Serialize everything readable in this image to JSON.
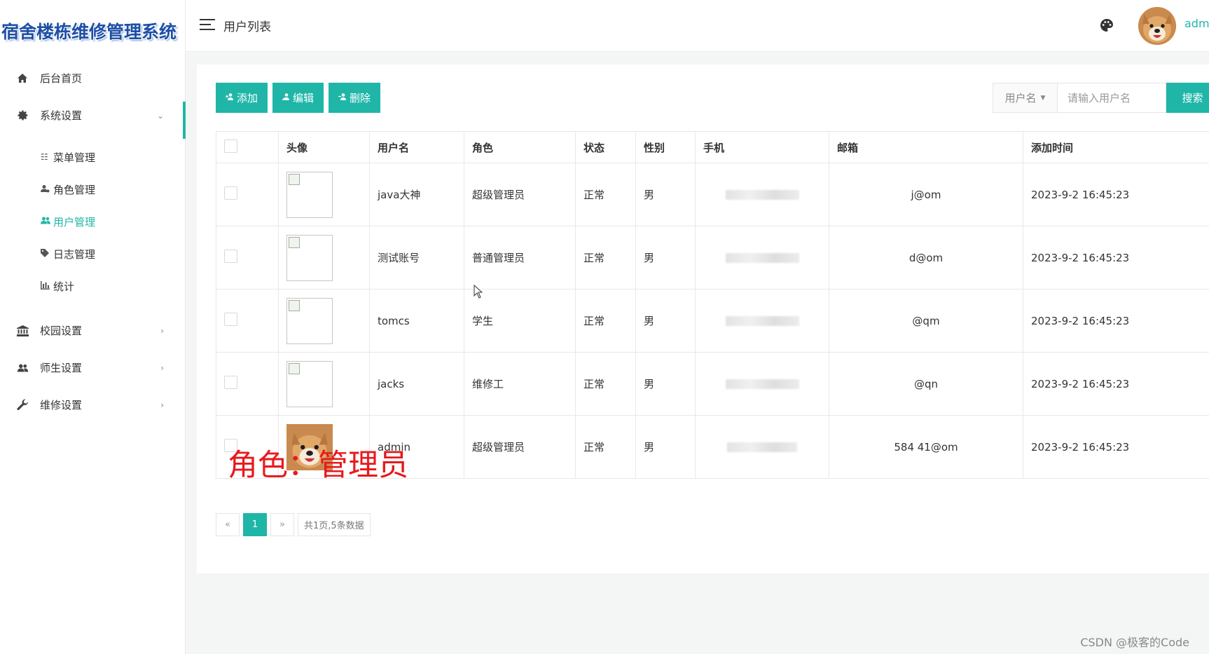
{
  "app": {
    "title": "宿舍楼栋维修管理系统"
  },
  "header": {
    "page_title": "用户列表",
    "user_name": "adm"
  },
  "sidebar": {
    "items": [
      {
        "label": "后台首页",
        "icon": "home-icon"
      },
      {
        "label": "系统设置",
        "icon": "gear-icon",
        "expanded": true,
        "children": [
          {
            "label": "菜单管理",
            "icon": "list-icon"
          },
          {
            "label": "角色管理",
            "icon": "user-gear-icon"
          },
          {
            "label": "用户管理",
            "icon": "users-icon",
            "active": true
          },
          {
            "label": "日志管理",
            "icon": "tag-icon"
          },
          {
            "label": "统计",
            "icon": "bar-chart-icon"
          }
        ]
      },
      {
        "label": "校园设置",
        "icon": "bank-icon"
      },
      {
        "label": "师生设置",
        "icon": "users-icon"
      },
      {
        "label": "维修设置",
        "icon": "wrench-icon"
      }
    ]
  },
  "toolbar": {
    "add_label": "添加",
    "edit_label": "编辑",
    "delete_label": "删除"
  },
  "search": {
    "field_select": "用户名",
    "placeholder": "请输入用户名",
    "button_label": "搜索"
  },
  "table": {
    "headers": [
      "头像",
      "用户名",
      "角色",
      "状态",
      "性别",
      "手机",
      "邮箱",
      "添加时间"
    ],
    "rows": [
      {
        "username": "java大神",
        "role": "超级管理员",
        "status": "正常",
        "gender": "男",
        "email": "j@om",
        "created": "2023-9-2 16:45:23",
        "avatar": "broken"
      },
      {
        "username": "测试账号",
        "role": "普通管理员",
        "status": "正常",
        "gender": "男",
        "email": "d@om",
        "created": "2023-9-2 16:45:23",
        "avatar": "broken"
      },
      {
        "username": "tomcs",
        "role": "学生",
        "status": "正常",
        "gender": "男",
        "email": "@qm",
        "created": "2023-9-2 16:45:23",
        "avatar": "broken"
      },
      {
        "username": "jacks",
        "role": "维修工",
        "status": "正常",
        "gender": "男",
        "email": "@qn",
        "created": "2023-9-2 16:45:23",
        "avatar": "broken"
      },
      {
        "username": "admin",
        "role": "超级管理员",
        "status": "正常",
        "gender": "男",
        "email": "584 41@om",
        "created": "2023-9-2 16:45:23",
        "avatar": "dog"
      }
    ]
  },
  "pagination": {
    "prev": "«",
    "current": "1",
    "next": "»",
    "summary": "共1页,5条数据"
  },
  "annotation": "角色：管理员",
  "watermark": "CSDN @极客的Code",
  "colors": {
    "accent": "#1fb6a8",
    "status_green": "#16a085",
    "annotation_red": "#e8191d"
  }
}
